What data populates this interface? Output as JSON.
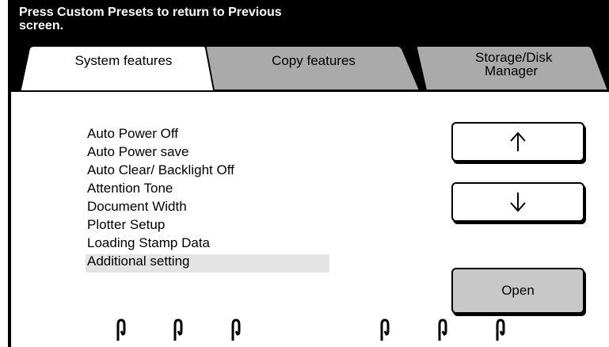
{
  "header": {
    "message": "Press Custom Presets to return to Previous screen."
  },
  "tabs": [
    {
      "label": "System features",
      "active": true
    },
    {
      "label": "Copy features",
      "active": false
    },
    {
      "label_line1": "Storage/Disk",
      "label_line2": "Manager",
      "active": false
    }
  ],
  "menu": {
    "items": [
      "Auto Power Off",
      "Auto Power save",
      "Auto Clear/ Backlight Off",
      "Attention Tone",
      "Document Width",
      "Plotter Setup",
      "Loading Stamp Data",
      "Additional setting"
    ],
    "selected_index": 7
  },
  "buttons": {
    "scroll_up_icon": "arrow-up-icon",
    "scroll_down_icon": "arrow-down-icon",
    "open_label": "Open"
  },
  "colors": {
    "header_bg": "#000000",
    "inactive_tab": "#aaaaaa",
    "selected_row": "#e4e4e4",
    "open_button": "#c8c8c8"
  },
  "footer_icons": [
    "clip-icon",
    "clip-icon",
    "clip-icon",
    "clip-icon",
    "clip-icon",
    "clip-icon"
  ]
}
